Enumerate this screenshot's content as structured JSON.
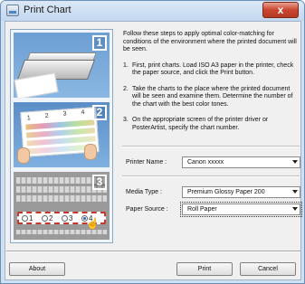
{
  "window": {
    "title": "Print Chart",
    "close_glyph": "x"
  },
  "illustration": {
    "step_numbers": [
      "1",
      "2",
      "3"
    ],
    "chart_numbers": [
      "1",
      "2",
      "3",
      "4"
    ],
    "option_numbers": [
      "1",
      "2",
      "3",
      "4"
    ]
  },
  "instructions": {
    "intro": "Follow these steps to apply optimal color-matching for conditions of the environment where the printed document will be seen.",
    "steps": [
      {
        "num": "1.",
        "text": "First, print charts. Load ISO A3 paper in the printer, check the paper source, and click the Print button."
      },
      {
        "num": "2.",
        "text": "Take the charts to the place where the printed document will be seen and examine them. Determine the number of the chart with the best color tones."
      },
      {
        "num": "3.",
        "text": "On the appropriate screen of the printer driver or PosterArtist, specify the chart number."
      }
    ]
  },
  "fields": {
    "printer_label": "Printer Name :",
    "printer_value": "Canon xxxxx",
    "media_label": "Media Type :",
    "media_value": "Premium Glossy Paper 200",
    "source_label": "Paper Source :",
    "source_value": "Roll Paper"
  },
  "buttons": {
    "about": "About",
    "print": "Print",
    "cancel": "Cancel"
  }
}
